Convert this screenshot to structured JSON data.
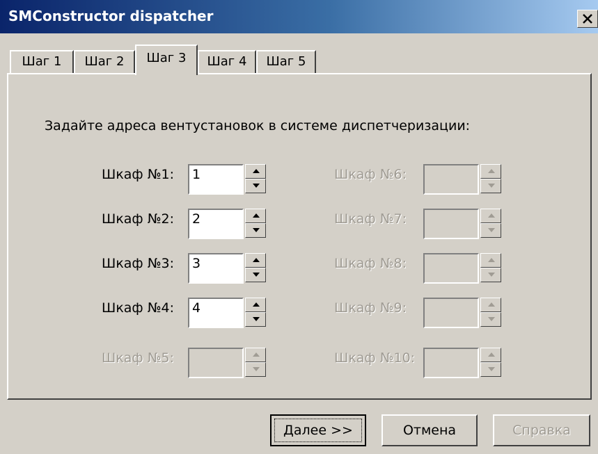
{
  "window": {
    "title": "SMConstructor dispatcher"
  },
  "tabs": [
    {
      "label": "Шаг 1",
      "active": false
    },
    {
      "label": "Шаг 2",
      "active": false
    },
    {
      "label": "Шаг 3",
      "active": true
    },
    {
      "label": "Шаг 4",
      "active": false
    },
    {
      "label": "Шаг 5",
      "active": false
    }
  ],
  "instruction": "Задайте адреса вентустановок в системе диспетчеризации:",
  "cabinets": [
    {
      "label": "Шкаф №1:",
      "value": "1",
      "enabled": true
    },
    {
      "label": "Шкаф №2:",
      "value": "2",
      "enabled": true
    },
    {
      "label": "Шкаф №3:",
      "value": "3",
      "enabled": true
    },
    {
      "label": "Шкаф №4:",
      "value": "4",
      "enabled": true
    },
    {
      "label": "Шкаф №5:",
      "value": "",
      "enabled": false
    },
    {
      "label": "Шкаф №6:",
      "value": "",
      "enabled": false
    },
    {
      "label": "Шкаф №7:",
      "value": "",
      "enabled": false
    },
    {
      "label": "Шкаф №8:",
      "value": "",
      "enabled": false
    },
    {
      "label": "Шкаф №9:",
      "value": "",
      "enabled": false
    },
    {
      "label": "Шкаф №10:",
      "value": "",
      "enabled": false
    }
  ],
  "buttons": {
    "next": "Далее >>",
    "cancel": "Отмена",
    "help": "Справка"
  },
  "colors": {
    "title_start": "#0a246a",
    "title_end": "#a6caf0",
    "face": "#d4d0c8",
    "disabled_text": "#a09c94"
  }
}
